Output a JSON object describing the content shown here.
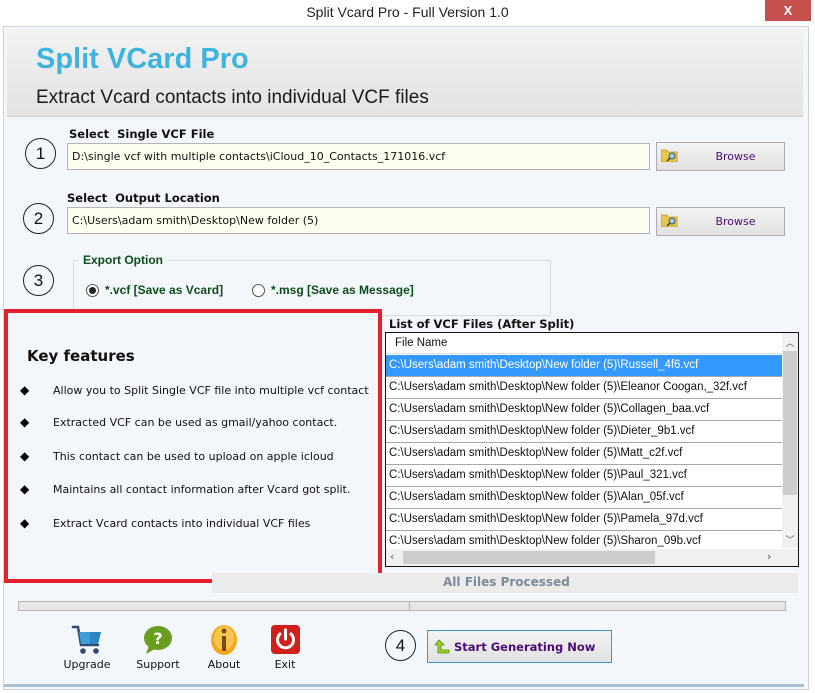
{
  "window": {
    "title": "Split Vcard Pro - Full Version 1.0",
    "close_label": "X"
  },
  "header": {
    "app_name": "Split VCard Pro",
    "tagline": "Extract Vcard contacts into individual VCF files",
    "accent_color": "#3fb3e0"
  },
  "steps": {
    "one": "1",
    "two": "2",
    "three": "3",
    "four": "4"
  },
  "source": {
    "label": "Select  Single VCF File",
    "value": "D:\\single vcf with multiple contacts\\iCloud_10_Contacts_171016.vcf",
    "browse_label": "Browse"
  },
  "output": {
    "label": "Select  Output Location",
    "value": "C:\\Users\\adam smith\\Desktop\\New folder (5)",
    "browse_label": "Browse"
  },
  "export": {
    "legend": "Export Option",
    "options": [
      {
        "label": "*.vcf [Save as Vcard]",
        "selected": true
      },
      {
        "label": "*.msg [Save as Message]",
        "selected": false
      }
    ]
  },
  "features": {
    "title": "Key features",
    "items": [
      "Allow you to Split Single VCF file into multiple vcf contact",
      "Extracted VCF can be used as gmail/yahoo contact.",
      "This contact can be used to upload on apple icloud",
      "Maintains all contact information after Vcard got split.",
      "Extract Vcard contacts into individual VCF files"
    ]
  },
  "file_list": {
    "title": "List of VCF Files (After Split)",
    "column_header": "File Name",
    "selected_index": 0,
    "rows": [
      "C:\\Users\\adam smith\\Desktop\\New folder (5)\\Russell_4f6.vcf",
      "C:\\Users\\adam smith\\Desktop\\New folder (5)\\Eleanor Coogan,_32f.vcf",
      "C:\\Users\\adam smith\\Desktop\\New folder (5)\\Collagen_baa.vcf",
      "C:\\Users\\adam smith\\Desktop\\New folder (5)\\Dieter_9b1.vcf",
      "C:\\Users\\adam smith\\Desktop\\New folder (5)\\Matt_c2f.vcf",
      "C:\\Users\\adam smith\\Desktop\\New folder (5)\\Paul_321.vcf",
      "C:\\Users\\adam smith\\Desktop\\New folder (5)\\Alan_05f.vcf",
      "C:\\Users\\adam smith\\Desktop\\New folder (5)\\Pamela_97d.vcf",
      "C:\\Users\\adam smith\\Desktop\\New folder (5)\\Sharon_09b.vcf"
    ]
  },
  "status": {
    "text": "All Files Processed"
  },
  "toolbar": {
    "upgrade_label": "Upgrade",
    "support_label": "Support",
    "about_label": "About",
    "exit_label": "Exit"
  },
  "start": {
    "label": "Start Generating Now"
  }
}
